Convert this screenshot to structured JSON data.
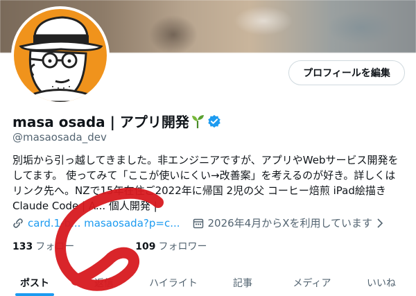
{
  "profile": {
    "name": "masa osada | アプリ開発",
    "handle": "@masaosada_dev",
    "edit_button": "プロフィールを編集",
    "bio_lines": [
      "別垢から引っ越してきました。非エンジニアですが、アプリやWebサービス開発を",
      "してます。 使ってみて「ここが使いにくい→改善案」を考えるのが好き。詳しくは",
      "リンク先へ。NZで15年在住ご2022年に帰国 2児の父 コーヒー焙煎 iPad絵描き",
      "Claude Code | A... 個人開発 |"
    ],
    "link": "card.1-b... masaosada?p=c...",
    "joined": "2026年4月からXを利用しています",
    "following_count": "133",
    "following_label": "フォロー",
    "followers_count": "109",
    "followers_label": "フォロワー"
  },
  "tabs": [
    {
      "label": "ポスト",
      "active": true
    },
    {
      "label": "返信",
      "active": false
    },
    {
      "label": "ハイライト",
      "active": false
    },
    {
      "label": "記事",
      "active": false
    },
    {
      "label": "メディア",
      "active": false
    },
    {
      "label": "いいね",
      "active": false
    }
  ],
  "colors": {
    "accent": "#1d9bf0",
    "avatar_bg": "#f0931c",
    "annotation": "#d7191f"
  }
}
